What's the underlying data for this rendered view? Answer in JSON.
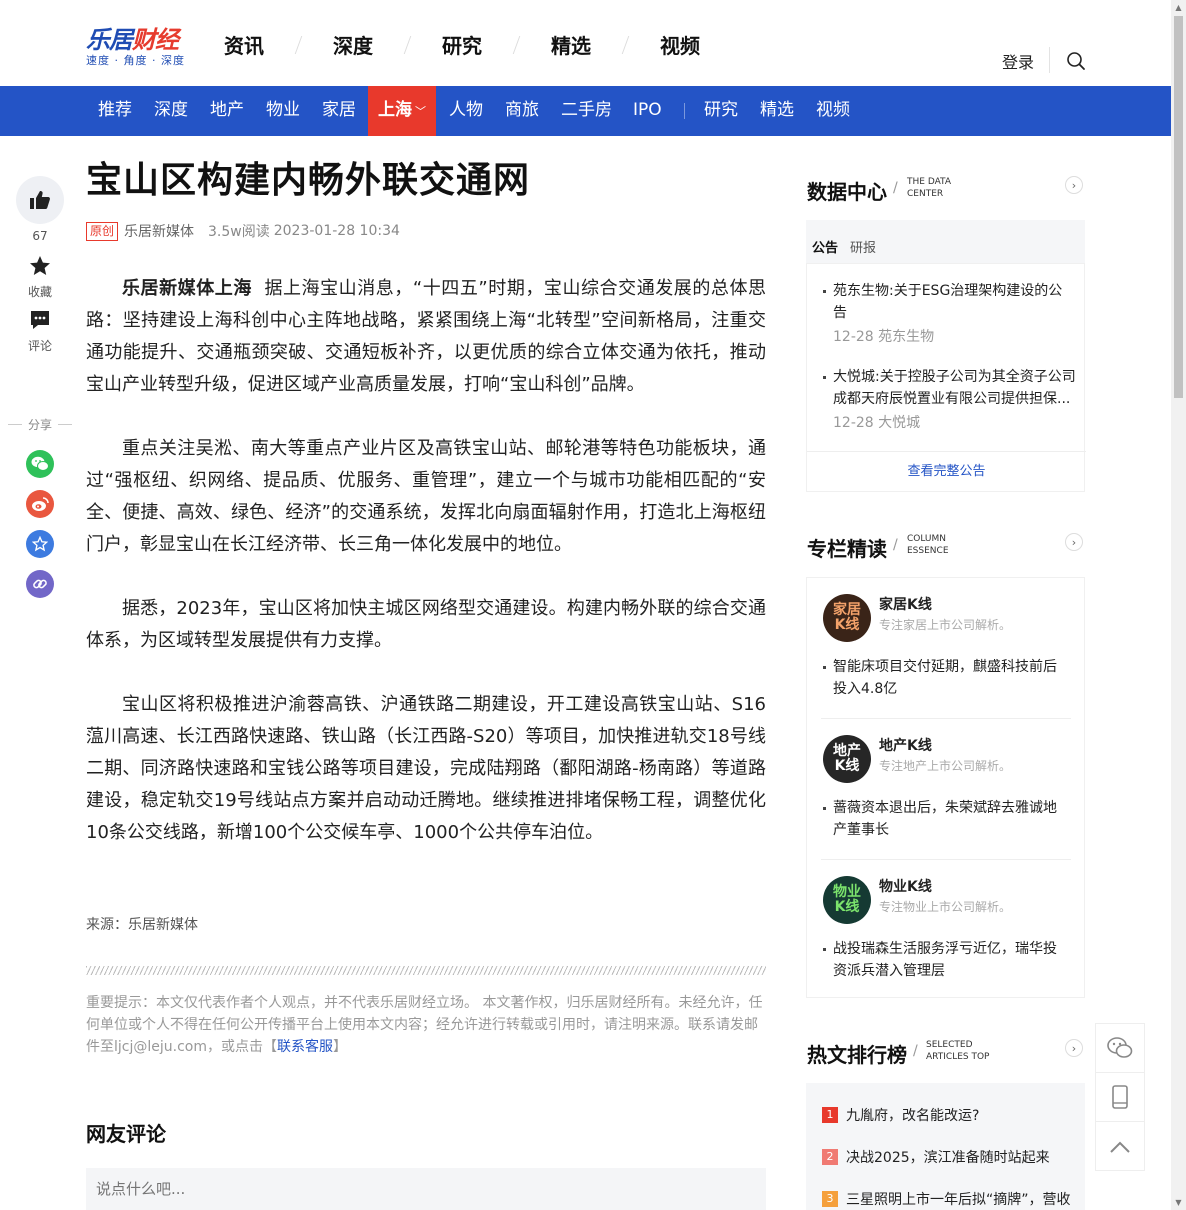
{
  "header": {
    "logo_main_a": "乐居",
    "logo_main_b": "财经",
    "logo_sub": "速度 · 角度 · 深度",
    "top_nav": [
      "资讯",
      "深度",
      "研究",
      "精选",
      "视频"
    ],
    "login": "登录"
  },
  "channels": [
    "推荐",
    "深度",
    "地产",
    "物业",
    "家居",
    "上海",
    "人物",
    "商旅",
    "二手房",
    "IPO",
    "研究",
    "精选",
    "视频"
  ],
  "active_channel": "上海",
  "rail": {
    "like_count": "67",
    "favorite": "收藏",
    "comment": "评论",
    "share": "分享"
  },
  "article": {
    "title": "宝山区构建内畅外联交通网",
    "badge": "原创",
    "author": "乐居新媒体",
    "reads": "3.5w阅读",
    "time": "2023-01-28 10:34",
    "lead": "乐居新媒体上海",
    "p1": "据上海宝山消息，“十四五”时期，宝山综合交通发展的总体思路：坚持建设上海科创中心主阵地战略，紧紧围绕上海“北转型”空间新格局，注重交通功能提升、交通瓶颈突破、交通短板补齐，以更优质的综合立体交通为依托，推动宝山产业转型升级，促进区域产业高质量发展，打响“宝山科创”品牌。",
    "p2": "重点关注吴淞、南大等重点产业片区及高铁宝山站、邮轮港等特色功能板块，通过“强枢纽、织网络、提品质、优服务、重管理”，建立一个与城市功能相匹配的“安全、便捷、高效、绿色、经济”的交通系统，发挥北向扇面辐射作用，打造北上海枢纽门户，彰显宝山在长江经济带、长三角一体化发展中的地位。",
    "p3": "据悉，2023年，宝山区将加快主城区网络型交通建设。构建内畅外联的综合交通体系，为区域转型发展提供有力支撑。",
    "p4": "宝山区将积极推进沪渝蓉高铁、沪通铁路二期建设，开工建设高铁宝山站、S16蕰川高速、长江西路快速路、铁山路（长江西路-S20）等项目，加快推进轨交18号线二期、同济路快速路和宝钱公路等项目建设，完成陆翔路（鄱阳湖路-杨南路）等道路建设，稳定轨交19号线站点方案并启动动迁腾地。继续推进排堵保畅工程，调整优化10条公交线路，新增100个公交候车亭、1000个公共停车泊位。",
    "source": "来源：乐居新媒体",
    "notice": "重要提示：本文仅代表作者个人观点，并不代表乐居财经立场。 本文著作权，归乐居财经所有。未经允许，任何单位或个人不得在任何公开传播平台上使用本文内容；经允许进行转载或引用时，请注明来源。联系请发邮件至ljcj@leju.com，或点击【",
    "notice_link": "联系客服",
    "notice_end": "】"
  },
  "comments": {
    "title": "网友评论",
    "placeholder": "说点什么吧..."
  },
  "sidebar": {
    "data_center": {
      "cn": "数据中心",
      "en1": "THE DATA",
      "en2": "CENTER",
      "tabs": [
        "公告",
        "研报"
      ],
      "items": [
        {
          "title": "苑东生物:关于ESG治理架构建设的公告",
          "date": "12-28 苑东生物"
        },
        {
          "title": "大悦城:关于控股子公司为其全资子公司成都天府辰悦置业有限公司提供担保...",
          "date": "12-28 大悦城"
        }
      ],
      "more": "查看完整公告"
    },
    "columns": {
      "cn": "专栏精读",
      "en1": "COLUMN",
      "en2": "ESSENCE",
      "items": [
        {
          "avatar": "家居\nK线",
          "name": "家居K线",
          "desc": "专注家居上市公司解析。",
          "article": "智能床项目交付延期，麒盛科技前后投入4.8亿"
        },
        {
          "avatar": "地产\nK线",
          "name": "地产K线",
          "desc": "专注地产上市公司解析。",
          "article": "蔷薇资本退出后，朱荣斌辞去雅诚地产董事长"
        },
        {
          "avatar": "物业\nK线",
          "name": "物业K线",
          "desc": "专注物业上市公司解析。",
          "article": "战投瑞森生活服务浮亏近亿，瑞华投资派兵潜入管理层"
        }
      ]
    },
    "hot": {
      "cn": "热文排行榜",
      "en1": "SELECTED",
      "en2": "ARTICLES TOP",
      "items": [
        {
          "rank": "1",
          "title": "九胤府，改名能改运?"
        },
        {
          "rank": "2",
          "title": "决战2025，滨江准备随时站起来"
        },
        {
          "rank": "3",
          "title": "三星照明上市一年后拟“摘牌”，营收"
        }
      ]
    }
  },
  "colors": {
    "brand_blue": "#2454c6",
    "active_red": "#e8392c",
    "wechat": "#2fc15a",
    "weibo": "#e9573f",
    "qzone": "#3d7be0",
    "link": "#7267c8"
  }
}
